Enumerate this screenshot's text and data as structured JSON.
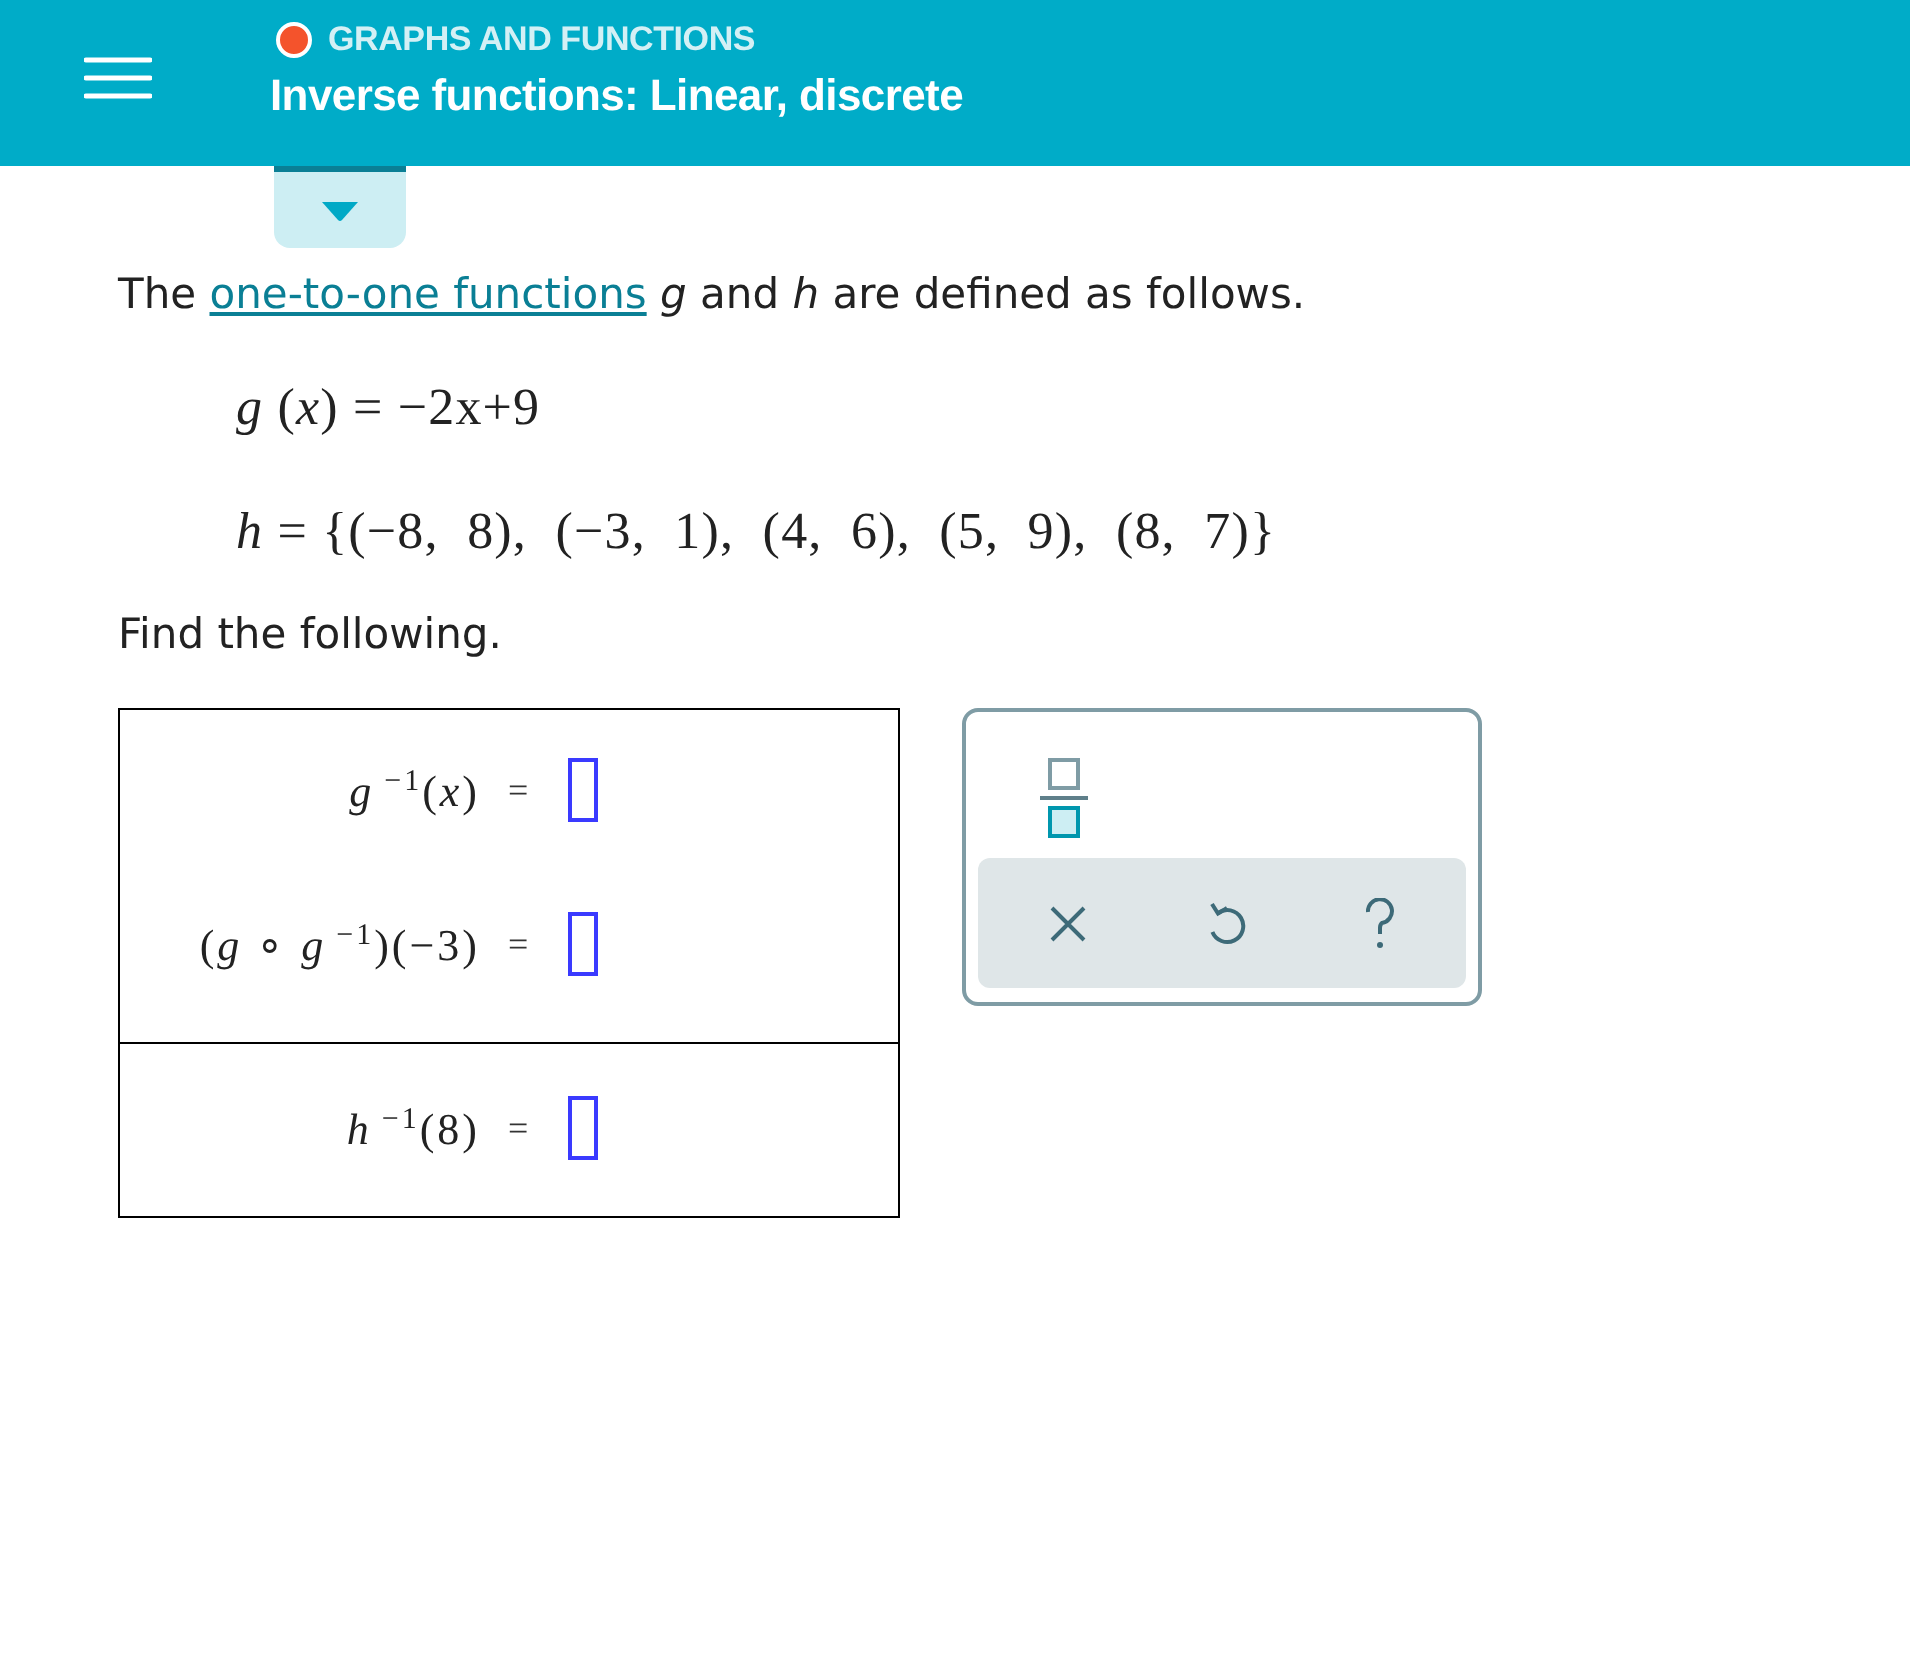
{
  "header": {
    "category": "GRAPHS AND FUNCTIONS",
    "title": "Inverse functions: Linear, discrete"
  },
  "intro": {
    "before": "The",
    "link": "one-to-one functions",
    "after": "*g* and *h* are defined as follows."
  },
  "definitions": [
    "*g* (*x*) = −2x+9",
    "*h* = {(−8,  8),  (−3,  1),  (4,  6),  (5,  9),  (8,  7)}"
  ],
  "prompt": "Find the following.",
  "table": {
    "rows": [
      {
        "items": [
          {
            "expression": "*g*$^{−1}$(*x*)",
            "relation": "="
          },
          {
            "expression": "(*g* ∘ *g*$^{−1}$)(−3)",
            "relation": "="
          }
        ]
      },
      {
        "items": [
          {
            "expression": "*h*$^{−1}$(8)",
            "relation": "="
          }
        ]
      }
    ]
  },
  "keypad": {
    "keys": [
      {
        "kind": "fraction"
      }
    ],
    "actions": [
      {
        "kind": "clear"
      },
      {
        "kind": "undo"
      },
      {
        "kind": "help"
      }
    ]
  }
}
